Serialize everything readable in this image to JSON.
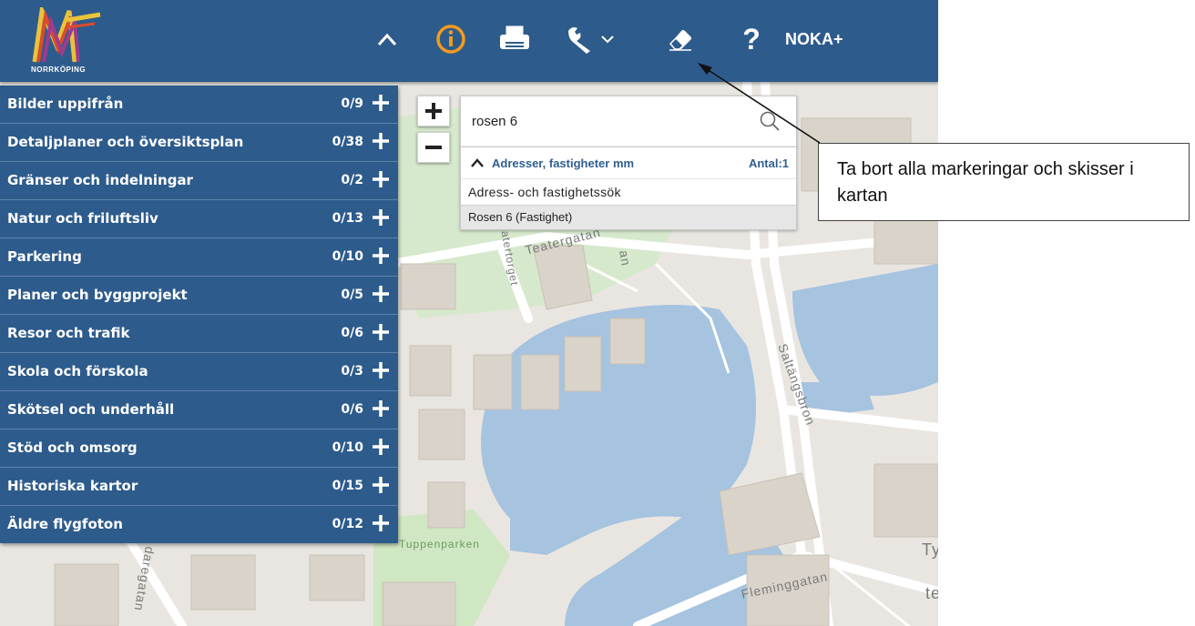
{
  "header": {
    "logo_text": "NORRKÖPING",
    "noka_label": "NOKA+"
  },
  "layers": [
    {
      "label": "Bilder uppifrån",
      "count": "0/9"
    },
    {
      "label": "Detaljplaner och översiktsplan",
      "count": "0/38"
    },
    {
      "label": "Gränser och indelningar",
      "count": "0/2"
    },
    {
      "label": "Natur och friluftsliv",
      "count": "0/13"
    },
    {
      "label": "Parkering",
      "count": "0/10"
    },
    {
      "label": "Planer och byggprojekt",
      "count": "0/5"
    },
    {
      "label": "Resor och trafik",
      "count": "0/6"
    },
    {
      "label": "Skola och förskola",
      "count": "0/3"
    },
    {
      "label": "Skötsel och underhåll",
      "count": "0/6"
    },
    {
      "label": "Stöd och omsorg",
      "count": "0/10"
    },
    {
      "label": "Historiska kartor",
      "count": "0/15"
    },
    {
      "label": "Äldre flygfoton",
      "count": "0/12"
    }
  ],
  "search": {
    "value": "rosen 6",
    "group_label": "Adresser, fastigheter mm",
    "group_count": "Antal:1",
    "subheading": "Adress- och fastighetssök",
    "result": "Rosen 6 (Fastighet)"
  },
  "map": {
    "labels": [
      "Teatergatan",
      "Teatertorget",
      "Saltängsbron",
      "Tuppenparken",
      "Fleminggatan",
      "daregatan",
      "Ty",
      "te",
      "an"
    ]
  },
  "callout": {
    "text": "Ta bort alla markeringar och skisser i kartan"
  },
  "colors": {
    "header_bg": "#2d5b8c",
    "panel_bg": "#2d5b8c",
    "info_orange": "#f39a1e",
    "water": "#a6c3df",
    "park": "#cfe7c3"
  }
}
